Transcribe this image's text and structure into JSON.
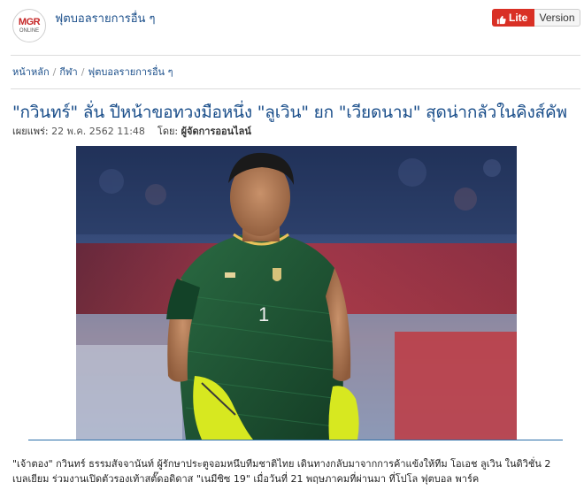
{
  "header": {
    "logo_top": "MGR",
    "logo_bottom": "ONLINE",
    "site_title": "ฟุตบอลรายการอื่น ๆ",
    "lite_label": "Lite",
    "version_label": "Version"
  },
  "breadcrumb": {
    "items": [
      "หน้าหลัก",
      "กีฬา",
      "ฟุตบอลรายการอื่น ๆ"
    ],
    "separator": "/"
  },
  "article": {
    "title": "\"กวินทร์\" ลั่น ปีหน้าขอทวงมือหนึ่ง \"ลูเวิน\" ยก \"เวียดนาม\" สุดน่ากลัวในคิงส์คัพ",
    "published_label": "เผยแพร่:",
    "published_date": "22 พ.ค. 2562 11:48",
    "author_label": "โดย:",
    "author": "ผู้จัดการออนไลน์",
    "body_line1": "\"เจ้าตอง\" กวินทร์ ธรรมสัจจานันท์ ผู้รักษาประตูจอมหนึบทีมชาติไทย เดินทางกลับมาจากการค้าแข้งให้ทีม โอเอช ลูเวิน ในดิวิชั่น 2",
    "body_line2": "เบลเยียม ร่วมงานเปิดตัวรองเท้าสตั๊ดอดิดาส \"เนมีซิซ 19\" เมื่อวันที่ 21 พฤษภาคมที่ผ่านมา ที่โปโล ฟุตบอล พาร์ค",
    "photo": {
      "jersey_number": "1",
      "colors": {
        "jersey": "#1f5a36",
        "gloves": "#d7e820",
        "background_red": "#b23340",
        "background_blue": "#2a3f7a"
      }
    }
  },
  "colors": {
    "link": "#1a4e8a",
    "lite_button": "#d93025",
    "accent_line": "#2b6ea8"
  }
}
